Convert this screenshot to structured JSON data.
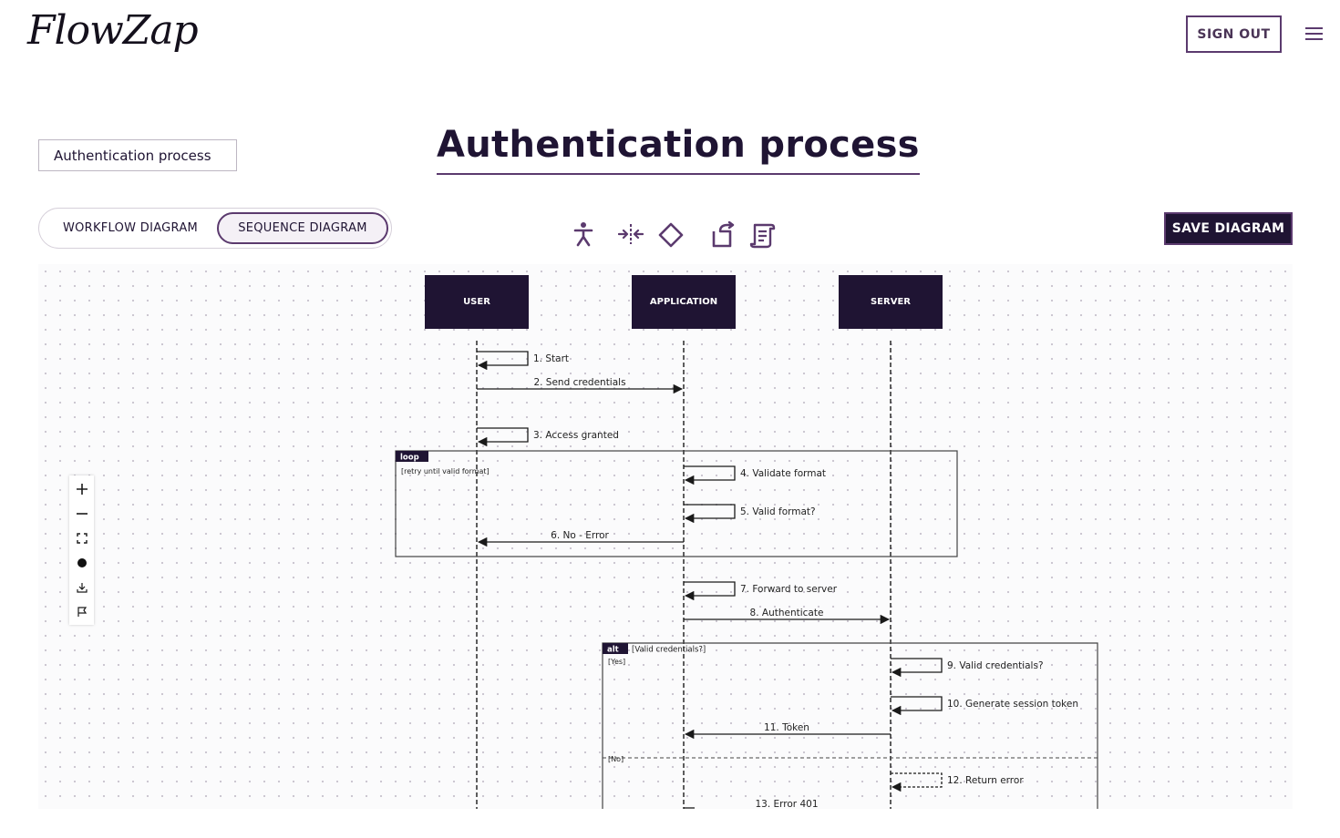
{
  "header": {
    "logo_text": "FlowZap",
    "signout_label": "SIGN OUT"
  },
  "diagram_name": {
    "value": "Authentication process",
    "placeholder": ""
  },
  "page_title": "Authentication process",
  "mode_toggle": {
    "workflow_label": "WORKFLOW DIAGRAM",
    "sequence_label": "SEQUENCE DIAGRAM",
    "active": "sequence"
  },
  "toolbar": {
    "icons": [
      "person-icon",
      "split-icon",
      "diamond-icon",
      "rotate-icon",
      "script-icon"
    ],
    "save_label": "SAVE DIAGRAM"
  },
  "zoom_controls": [
    "zoom-in-icon",
    "zoom-out-icon",
    "fit-view-icon",
    "toggle-icon",
    "download-icon",
    "flag-icon"
  ],
  "colors": {
    "primary": "#1f1433",
    "accent": "#5b3a6e"
  },
  "sequence": {
    "actors": [
      "USER",
      "APPLICATION",
      "SERVER"
    ],
    "messages": [
      {
        "from": "USER",
        "to": "USER",
        "label": "1. Start"
      },
      {
        "from": "USER",
        "to": "APPLICATION",
        "label": "2. Send credentials"
      },
      {
        "from": "USER",
        "to": "USER",
        "label": "3. Access granted"
      },
      {
        "from": "APPLICATION",
        "to": "APPLICATION",
        "label": "4. Validate format"
      },
      {
        "from": "APPLICATION",
        "to": "APPLICATION",
        "label": "5. Valid format?"
      },
      {
        "from": "APPLICATION",
        "to": "USER",
        "label": "6. No - Error"
      },
      {
        "from": "APPLICATION",
        "to": "APPLICATION",
        "label": "7. Forward to server"
      },
      {
        "from": "APPLICATION",
        "to": "SERVER",
        "label": "8. Authenticate"
      },
      {
        "from": "SERVER",
        "to": "SERVER",
        "label": "9. Valid credentials?"
      },
      {
        "from": "SERVER",
        "to": "SERVER",
        "label": "10. Generate session token"
      },
      {
        "from": "SERVER",
        "to": "APPLICATION",
        "label": "11. Token"
      },
      {
        "from": "SERVER",
        "to": "SERVER",
        "label": "12. Return error",
        "style": "dashed"
      },
      {
        "from": "APPLICATION",
        "to": "APPLICATION",
        "label": "13. Error 401"
      }
    ],
    "frames": [
      {
        "kind": "loop",
        "condition": "[retry until valid format]"
      },
      {
        "kind": "alt",
        "condition": "[Valid credentials?]",
        "branches": [
          "[Yes]",
          "[No]"
        ]
      }
    ]
  }
}
